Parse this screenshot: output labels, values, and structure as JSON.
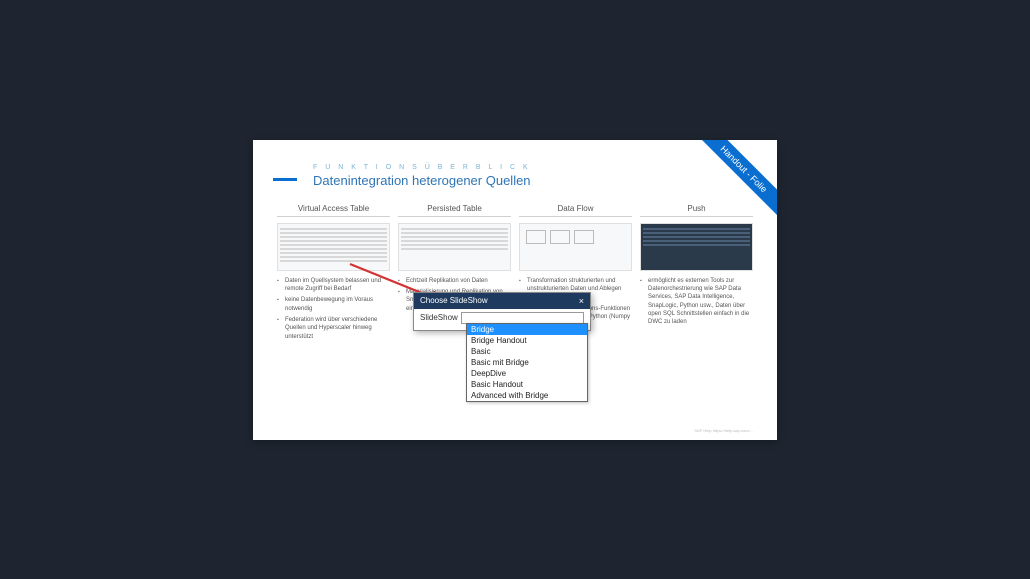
{
  "ribbon": "Handout - Folie",
  "eyebrow": "F U N K T I O N S Ü B E R B L I C K",
  "title": "Datenintegration heterogener Quellen",
  "columns": [
    {
      "title": "Virtual Access Table",
      "bullets": [
        "Daten im Quellsystem belassen und remote Zugriff bei Bedarf",
        "keine Datenbewegung im Voraus notwendig",
        "Federation wird über verschiedene Quellen und Hyperscaler hinweg unterstützt"
      ]
    },
    {
      "title": "Persisted Table",
      "bullets": [
        "Echtzeit Replikation von Daten",
        "Materialisierung und Replikation von Snapshots über automatisierte und eingeplante Daten"
      ]
    },
    {
      "title": "Data Flow",
      "bullets": [
        "Transformation strukturierten und unstrukturierten Daten und Ablegen von ETL - Pipelines",
        "Komplexe Transformations-Funktionen unter Verwendung von Python (Numpy / Pandas)"
      ]
    },
    {
      "title": "Push",
      "bullets": [
        "ermöglicht es externen Tools zur Datenorchestrierung wie SAP Data Services, SAP Data Intelligence, SnapLogic, Python usw., Daten über open SQL Schnittstellen einfach in die DWC zu laden"
      ]
    }
  ],
  "dialog": {
    "title": "Choose SlideShow",
    "label": "SlideShow",
    "options": [
      "Bridge",
      "Bridge Handout",
      "Basic",
      "Basic mit Bridge",
      "DeepDive",
      "Basic Handout",
      "Advanced with Bridge"
    ]
  },
  "footer": "SAP Help https://help.sap.com/..."
}
